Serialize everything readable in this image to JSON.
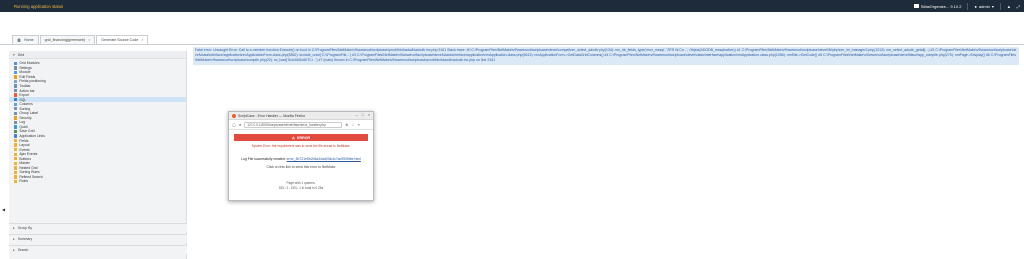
{
  "topbar": {
    "title": "Running application status",
    "project": "SifasOrgenize... 9.10.2",
    "user": "admin"
  },
  "tabs": [
    {
      "label": "Home"
    },
    {
      "label": "grid_financing(greenweb)"
    },
    {
      "label": "Generate Source Code"
    }
  ],
  "sidebar": {
    "header": "Grid",
    "items": [
      {
        "label": "Grid Modules",
        "color": "#5b8bd0"
      },
      {
        "label": "Settings",
        "color": "#7a8aa0"
      },
      {
        "label": "Module",
        "color": "#5b9bd5"
      },
      {
        "label": "Edit Fields",
        "color": "#e0a030"
      },
      {
        "label": "Fields positioning",
        "color": "#8aa0b8"
      },
      {
        "label": "Toolbar",
        "color": "#6f8fb0"
      },
      {
        "label": "Action bar",
        "color": "#7090b0"
      },
      {
        "label": "Export",
        "color": "#e05a3c"
      },
      {
        "label": "SQL",
        "color": "#3a7bc8"
      },
      {
        "label": "Columns",
        "color": "#5aa0d0"
      },
      {
        "label": "Sorting",
        "color": "#8090a8"
      },
      {
        "label": "Group Label",
        "color": "#7a8aa0"
      },
      {
        "label": "Security",
        "color": "#d9a030"
      },
      {
        "label": "Log",
        "color": "#7f8c99"
      },
      {
        "label": "Quicli",
        "color": "#4a90c8"
      },
      {
        "label": "Save Grid",
        "color": "#5a8a5a"
      },
      {
        "label": "Application Links",
        "color": "#4a80c0"
      },
      {
        "label": "Fields",
        "color": "#e8b04a"
      },
      {
        "label": "Layout",
        "color": "#e8b04a"
      },
      {
        "label": "Events",
        "color": "#e8b04a"
      },
      {
        "label": "Ajax Events",
        "color": "#e8b04a"
      },
      {
        "label": "Buttons",
        "color": "#e8b04a"
      },
      {
        "label": "Master",
        "color": "#e8b04a"
      },
      {
        "label": "Nested Grid",
        "color": "#e8b04a"
      },
      {
        "label": "Sorting Rules",
        "color": "#e8b04a"
      },
      {
        "label": "Refined Search",
        "color": "#e8b04a"
      },
      {
        "label": "Rules",
        "color": "#e8b04a"
      }
    ],
    "selected_index": 8,
    "groups": [
      {
        "label": "Group By"
      },
      {
        "label": "Summary"
      },
      {
        "label": "Search"
      }
    ]
  },
  "error_text": "Fatal error: Uncaught Error: Call to a member function Execute() on bool in C:\\ProgramFiles\\NetMake\\v9\\wwwroot\\scriptcase\\prod\\third\\adodb\\adodb.inc.php:2161 Stack trace: #0 C:\\ProgramFiles\\NetMake\\v9\\wwwroot\\scriptcase\\devel\\compat\\nm_select_adodb.php(134): nm_db_fields_type('nmx_mssql', 'SFR W.Cn...', Object(ADODB_mssqlnative)) #1 C:\\ProgramFiles\\NetMake\\v9\\wwwroot\\scriptcase\\devel\\lib\\php\\nm_ini_manager2.php(1012): nm_select_adodb_getall(...) #2 C:\\ProgramFiles\\NetMake\\v9\\wwwroot\\scriptcase\\devel\\class\\interface\\application\\nmApplicationForm.class.php(8362): include_once('C:\\\\ProgramFile...') #3 C:\\ProgramFiles\\NetMake\\v9\\wwwroot\\scriptcase\\devel\\class\\interface\\application\\nmApplication.class.php(6613): nmApplicationForm->GetDataGridColumns() #4 C:\\ProgramFiles\\NetMake\\v9\\wwwroot\\scriptcase\\devel\\class\\interface\\application\\nmApplication.class.php(1056): nmSite->GetCode() #5 C:\\ProgramFiles\\NetMake\\v9\\wwwroot\\scriptcase\\devel\\iface\\app_compile.php(275): nmPage->Display() #6 C:\\ProgramFiles\\NetMake\\v9\\wwwroot\\scriptcase\\compile.php(22): sc_load('ScIx4M2c66TCI...') #7 {main} thrown in C:\\ProgramFiles\\NetMake\\v9\\wwwroot\\scriptcase\\prod\\third\\adodb\\adodb.inc.php on line 2161",
  "popup": {
    "title": "ScriptCase - Error Handler — Mozilla Firefox",
    "url": "127.0.0.1:8092/scriptcase/devel/iface/error_handler.php",
    "error_label": "ERROR",
    "error_message": "System Error: the requirement was to send the file ahead to NetMake.",
    "log_text": "Log File successfully created:",
    "log_link": "error_5b721e5b2b5a34ad03fc4c7ac9505fbe.html",
    "click_text": "Click on this link to send this error to NetMake",
    "footer1": "Page with 1 queries.",
    "footer2": "SEL: 2 - DEL: 1 in total in 0.25s"
  }
}
